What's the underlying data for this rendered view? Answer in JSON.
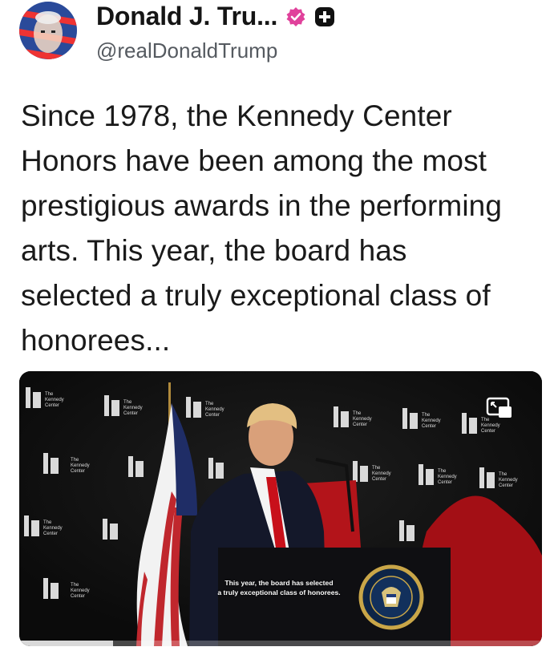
{
  "profile": {
    "display_name": "Donald J. Tru...",
    "handle": "@realDonaldTrump",
    "verified_badge_color": "#e0419b",
    "plus_badge_color": "#111111"
  },
  "post": {
    "text": "Since 1978, the Kennedy Center Honors have been among the most prestigious awards in the performing arts. This year, the board has selected a truly exceptional class of honorees..."
  },
  "media": {
    "backdrop_logo": [
      "The",
      "Kennedy",
      "Center"
    ],
    "caption_line1": "This year, the board has selected",
    "caption_line2": "a truly exceptional class of honorees.",
    "seal_text": "SEAL OF THE PRESIDENT OF THE UNITED STATES",
    "progress_fraction": 0.18,
    "icons": [
      "expand-icon",
      "presidential-seal"
    ]
  }
}
